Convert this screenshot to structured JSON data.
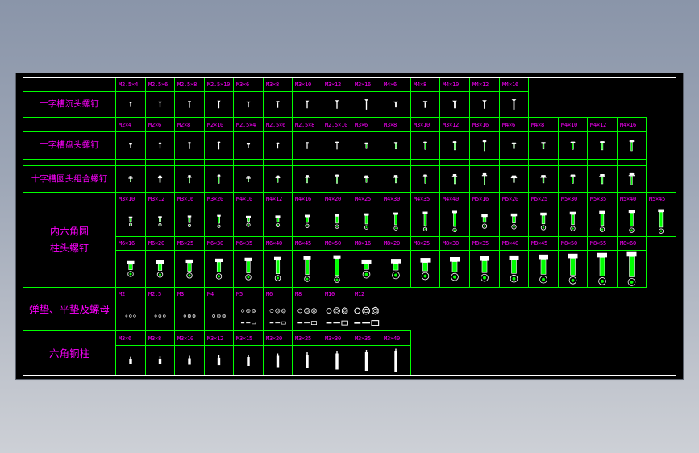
{
  "drawing": {
    "colors": {
      "text": "#ff00ff",
      "grid": "#00ff00",
      "part": "#ffffff",
      "frame": "#ffffff",
      "sheet": "#000000"
    },
    "sections": [
      {
        "label_lines": [
          "十字槽沉头螺钉"
        ],
        "part": "countersunk-screw-icon",
        "bands": [
          {
            "sizes": [
              "M2.5×4",
              "M2.5×6",
              "M2.5×8",
              "M2.5×10",
              "M3×6",
              "M3×8",
              "M3×10",
              "M3×12",
              "M3×16",
              "M4×6",
              "M4×8",
              "M4×10",
              "M4×12",
              "M4×16"
            ]
          }
        ]
      },
      {
        "label_lines": [
          "十字槽盘头螺钉"
        ],
        "part": "pan-head-screw-icon",
        "bands": [
          {
            "sizes": [
              "M2×4",
              "M2×6",
              "M2×8",
              "M2×10",
              "M2.5×4",
              "M2.5×6",
              "M2.5×8",
              "M2.5×10",
              "M3×6",
              "M3×8",
              "M3×10",
              "M3×12",
              "M3×16",
              "M4×6",
              "M4×8",
              "M4×10",
              "M4×12",
              "M4×16"
            ]
          }
        ]
      },
      {
        "label_lines": [
          "十字槽圆头组合螺钉"
        ],
        "part": "combination-screw-icon",
        "bands": [
          {
            "sizes": [
              "",
              "",
              "",
              "",
              "",
              "",
              "",
              "",
              "",
              "",
              "",
              "",
              "",
              "",
              "",
              "",
              "",
              ""
            ]
          }
        ]
      },
      {
        "label_lines": [
          "内六角圆",
          "柱头螺钉"
        ],
        "part": "socket-head-screw-icon",
        "bands": [
          {
            "sizes": [
              "M3×10",
              "M3×12",
              "M3×16",
              "M3×20",
              "M4×10",
              "M4×12",
              "M4×16",
              "M4×20",
              "M4×25",
              "M4×30",
              "M4×35",
              "M4×40",
              "M5×16",
              "M5×20",
              "M5×25",
              "M5×30",
              "M5×35",
              "M5×40",
              "M5×45"
            ]
          },
          {
            "sizes": [
              "M6×16",
              "M6×20",
              "M6×25",
              "M6×30",
              "M6×35",
              "M6×40",
              "M6×45",
              "M6×50",
              "M8×16",
              "M8×20",
              "M8×25",
              "M8×30",
              "M8×35",
              "M8×40",
              "M8×45",
              "M8×50",
              "M8×55",
              "M8×60"
            ]
          }
        ]
      },
      {
        "label_lines": [
          "弹垫、平垫及螺母"
        ],
        "part": "washer-nut-icon",
        "bands": [
          {
            "sizes": [
              "M2",
              "M2.5",
              "M3",
              "M4",
              "M5",
              "M6",
              "M8",
              "M10",
              "M12"
            ]
          }
        ]
      },
      {
        "label_lines": [
          "六角铜柱"
        ],
        "part": "hex-standoff-icon",
        "bands": [
          {
            "sizes": [
              "M3×6",
              "M3×8",
              "M3×10",
              "M3×12",
              "M3×15",
              "M3×20",
              "M3×25",
              "M3×30",
              "M3×35",
              "M3×40"
            ]
          }
        ]
      }
    ]
  }
}
